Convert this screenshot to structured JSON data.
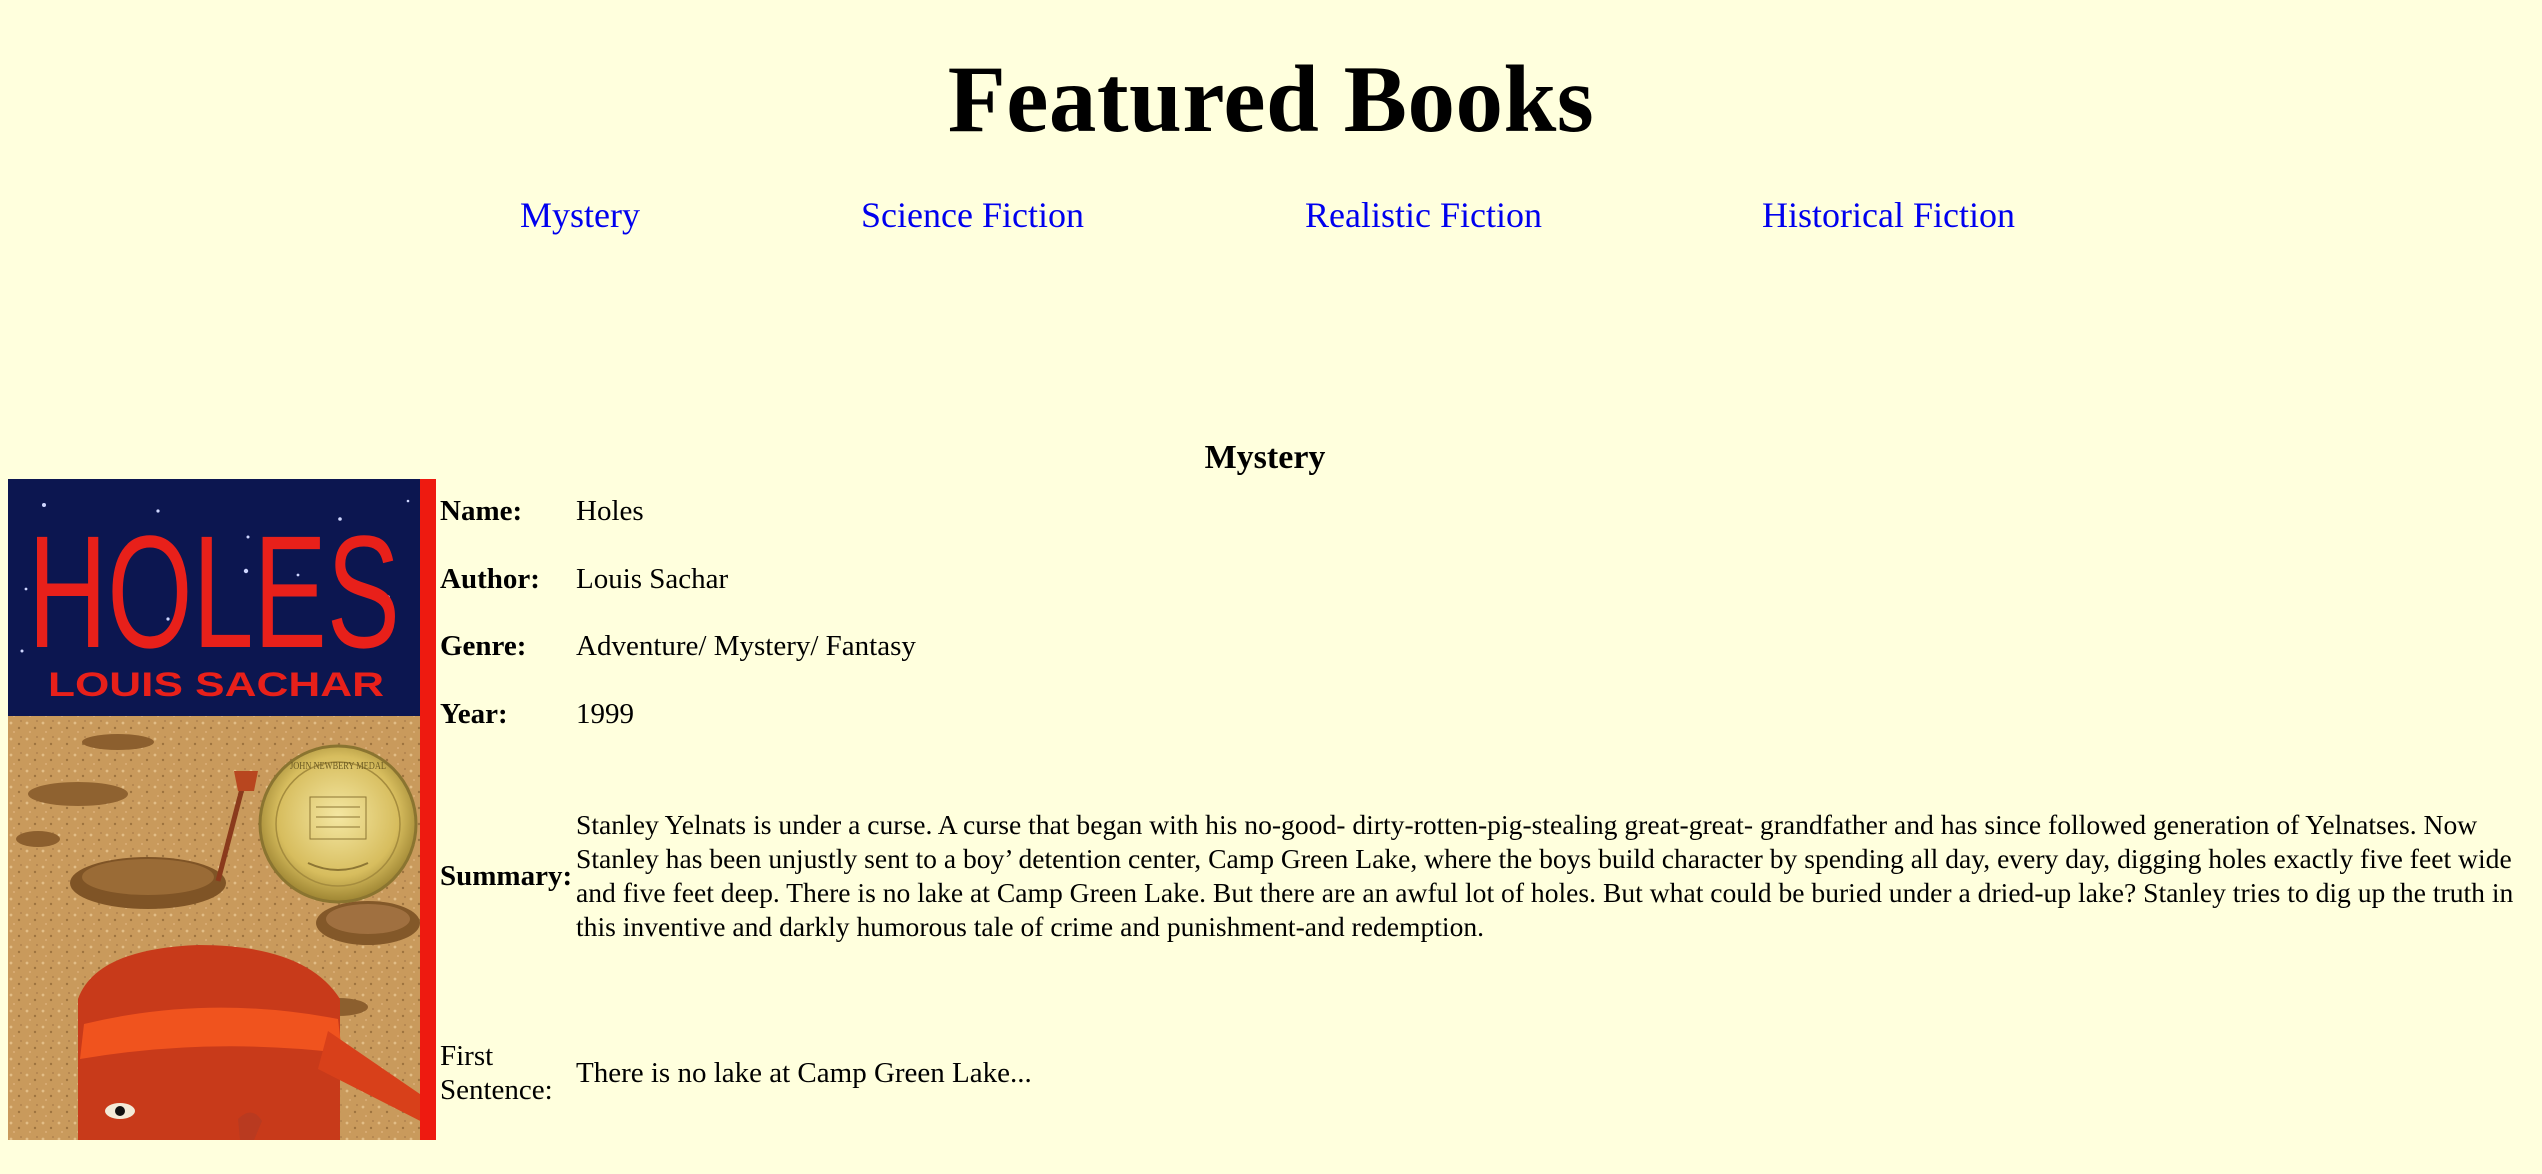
{
  "page": {
    "title": "Featured Books"
  },
  "nav": {
    "links": [
      {
        "label": "Mystery"
      },
      {
        "label": "Science Fiction"
      },
      {
        "label": "Realistic Fiction"
      },
      {
        "label": "Historical Fiction"
      }
    ]
  },
  "section": {
    "heading": "Mystery"
  },
  "book": {
    "cover": {
      "title_text": "HOLES",
      "author_text": "LOUIS SACHAR",
      "medal_text": "JOHN NEWBERY MEDAL"
    },
    "labels": {
      "name": "Name:",
      "author": "Author:",
      "genre": "Genre:",
      "year": "Year:",
      "summary": "Summary:",
      "first_sentence_line1": "First",
      "first_sentence_line2": "Sentence:"
    },
    "name": "Holes",
    "author": "Louis Sachar",
    "genre": "Adventure/ Mystery/ Fantasy",
    "year": "1999",
    "summary": "Stanley Yelnats is under a curse. A curse that began with his no-good- dirty-rotten-pig-stealing great-great- grandfather and has since followed generation of Yelnatses. Now Stanley has been unjustly sent to a boy’ detention center, Camp Green Lake, where the boys build character by spending all day, every day, digging holes exactly five feet wide and five feet deep. There is no lake at Camp Green Lake. But there are an awful lot of holes. But what could be buried under a dried-up lake? Stanley tries to dig up the truth in this inventive and darkly humorous tale of crime and punishment-and redemption.",
    "first_sentence": "There is no lake at Camp Green Lake..."
  },
  "colors": {
    "background": "#ffffdd",
    "link": "#0000ee",
    "cover_sky": "#0c1650",
    "cover_title": "#e8201a",
    "cover_spine": "#ee1a10",
    "cover_sand": "#c99a5c"
  }
}
